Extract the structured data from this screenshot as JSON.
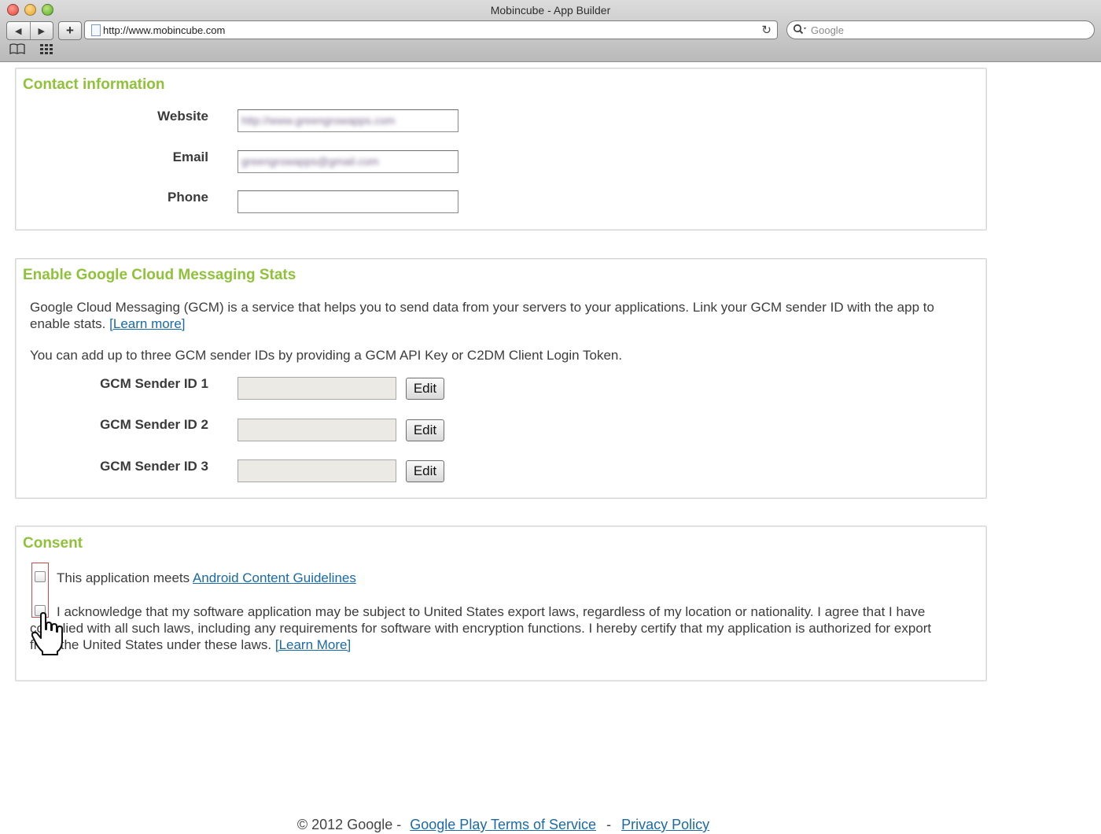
{
  "browser": {
    "window_title": "Mobincube - App Builder",
    "back_icon": "◀",
    "forward_icon": "▶",
    "plus_icon": "+",
    "url": "http://www.mobincube.com",
    "reload_icon": "↻",
    "search_placeholder": "Google",
    "search_icon_glyph": "🔍",
    "bookmarks_icon": "📖",
    "grid_icon": "▦"
  },
  "contact": {
    "title": "Contact information",
    "website_label": "Website",
    "website_value": "http://www.greengrowapps.com",
    "email_label": "Email",
    "email_value": "greengrowapps@gmail.com",
    "phone_label": "Phone",
    "phone_value": ""
  },
  "gcm": {
    "title": "Enable Google Cloud Messaging Stats",
    "desc1": "Google Cloud Messaging (GCM) is a service that helps you to send data from your servers to your applications. Link your GCM sender ID with the app to enable stats.",
    "learn_more": "[Learn more]",
    "desc2": "You can add up to three GCM sender IDs by providing a GCM API Key or C2DM Client Login Token.",
    "senders": [
      {
        "label": "GCM Sender ID 1",
        "button": "Edit"
      },
      {
        "label": "GCM Sender ID 2",
        "button": "Edit"
      },
      {
        "label": "GCM Sender ID 3",
        "button": "Edit"
      }
    ]
  },
  "consent": {
    "title": "Consent",
    "item1_prefix": "This application meets",
    "item1_link": "Android Content Guidelines",
    "item2_text": "I acknowledge that my software application may be subject to United States export laws, regardless of my location or nationality. I agree that I have complied with all such laws, including any requirements for software with encryption functions. I hereby certify that my application is authorized for export from the United States under these laws.",
    "item2_link": "[Learn More]"
  },
  "footer": {
    "copyright": "© 2012 Google -",
    "terms": "Google Play Terms of Service",
    "sep": "-",
    "privacy": "Privacy Policy"
  }
}
